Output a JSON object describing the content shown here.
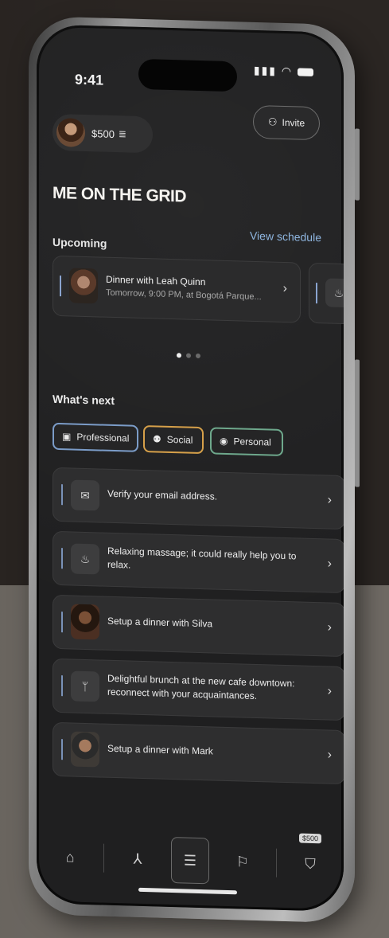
{
  "status_bar": {
    "time": "9:41",
    "signal_icon": "signal-icon",
    "wifi_icon": "wifi-icon",
    "battery_icon": "battery-icon"
  },
  "header": {
    "balance": "$500",
    "coin_icon": "coin-stack-icon",
    "invite_label": "Invite",
    "invite_icon": "add-person-icon"
  },
  "page_title": "ME ON THE GRID",
  "upcoming": {
    "heading": "Upcoming",
    "view_schedule": "View schedule",
    "events": [
      {
        "title": "Dinner with Leah Quinn",
        "subtitle": "Tomorrow, 9:00 PM, at Bogotá Parque..."
      },
      {
        "icon": "massage-icon"
      }
    ],
    "carousel_dots": 3,
    "active_dot": 0
  },
  "whats_next": {
    "heading": "What's next",
    "filters": [
      {
        "label": "Professional",
        "icon": "briefcase-icon",
        "color": "#7b9cc8"
      },
      {
        "label": "Social",
        "icon": "people-icon",
        "color": "#d6a04a"
      },
      {
        "label": "Personal",
        "icon": "person-circle-icon",
        "color": "#6ea88c"
      }
    ],
    "tasks": [
      {
        "text": "Verify your email address.",
        "icon": "email-icon"
      },
      {
        "text": "Relaxing massage; it could really help you to relax.",
        "icon": "massage-icon"
      },
      {
        "text": "Setup a dinner with Silva",
        "icon": "avatar-photo"
      },
      {
        "text": "Delightful brunch at the new cafe downtown: reconnect with your acquaintances.",
        "icon": "cutlery-icon"
      },
      {
        "text": "Setup a dinner with Mark",
        "icon": "avatar-photo"
      }
    ]
  },
  "tab_bar": {
    "items": [
      "home-icon",
      "network-icon",
      "list-icon",
      "flag-icon",
      "shield-plus-icon"
    ],
    "active_index": 2,
    "badge": "$500"
  }
}
